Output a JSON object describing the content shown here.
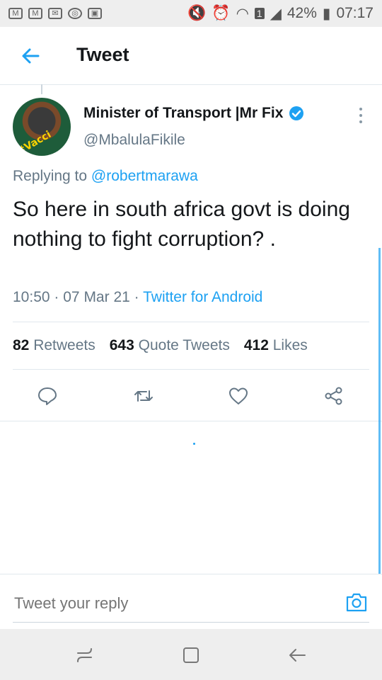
{
  "status_bar": {
    "battery": "42%",
    "time": "07:17",
    "sim": "1"
  },
  "header": {
    "title": "Tweet"
  },
  "tweet": {
    "author_name": "Minister of Transport |Mr Fix",
    "handle": "@MbalulaFikile",
    "avatar_text": "#Vacci",
    "replying_prefix": "Replying to",
    "replying_to": "@robertmarawa",
    "text": "So here in south africa govt is doing nothing to fight corruption? .",
    "time": "10:50",
    "date": "07 Mar 21",
    "source": "Twitter for Android",
    "retweets_count": "82",
    "retweets_label": "Retweets",
    "quotes_count": "643",
    "quotes_label": "Quote Tweets",
    "likes_count": "412",
    "likes_label": "Likes"
  },
  "reply": {
    "placeholder": "Tweet your reply"
  },
  "colors": {
    "accent": "#1da1f2",
    "muted": "#657786",
    "text": "#14171a",
    "divider": "#e1e8ed"
  },
  "icons": [
    "back-arrow-icon",
    "verified-icon",
    "more-icon",
    "reply-icon",
    "retweet-icon",
    "like-icon",
    "share-icon",
    "camera-icon",
    "recents-nav-icon",
    "home-nav-icon",
    "back-nav-icon"
  ]
}
